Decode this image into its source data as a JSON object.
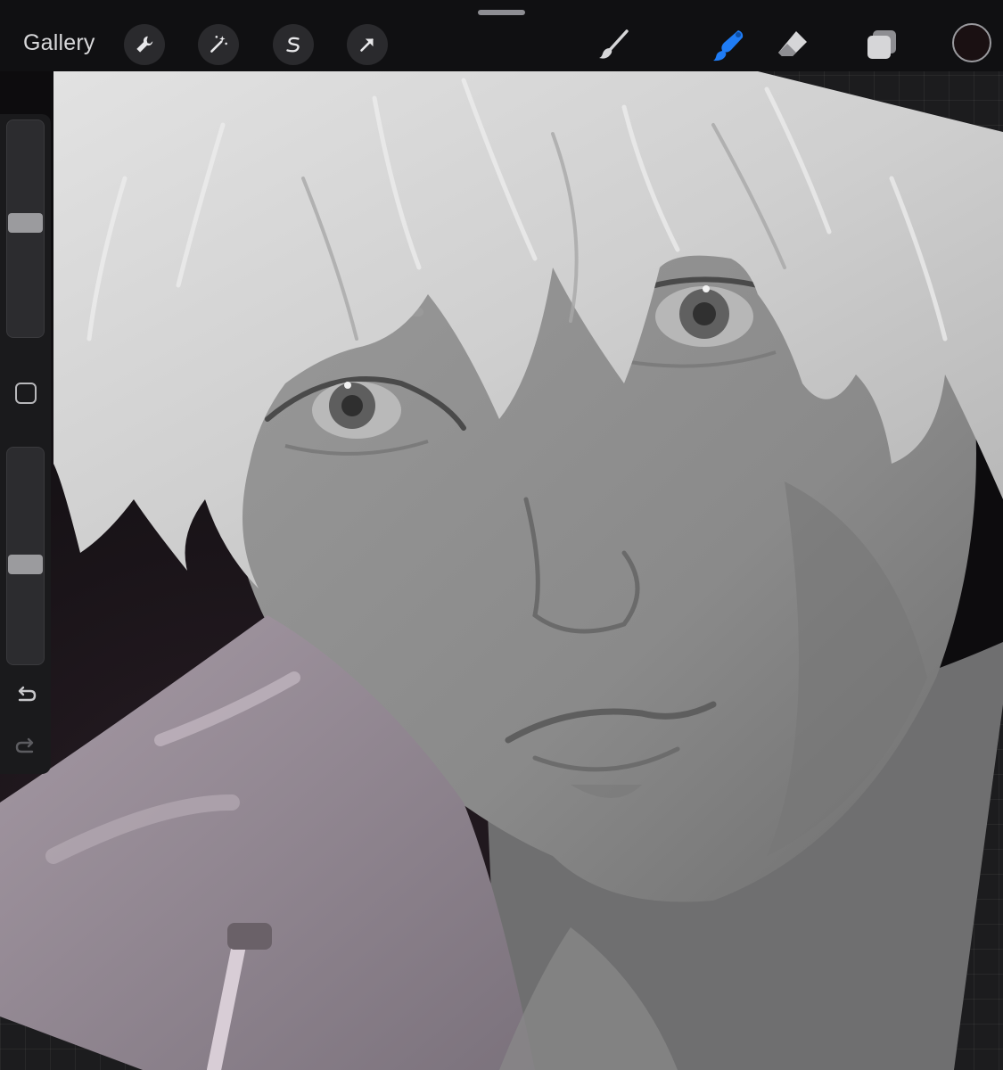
{
  "topbar": {
    "gallery_label": "Gallery",
    "left_tools": [
      "wrench-icon",
      "magic-wand-icon",
      "selection-icon",
      "transform-arrow-icon"
    ],
    "right_tools": [
      "brush-icon",
      "smudge-icon",
      "eraser-icon",
      "layers-icon"
    ],
    "active_tool": "smudge",
    "active_color": "#1a1012",
    "accent_color": "#1f7cf5"
  },
  "sidebar": {
    "brush_size_level": 0.46,
    "opacity_level": 0.55
  }
}
